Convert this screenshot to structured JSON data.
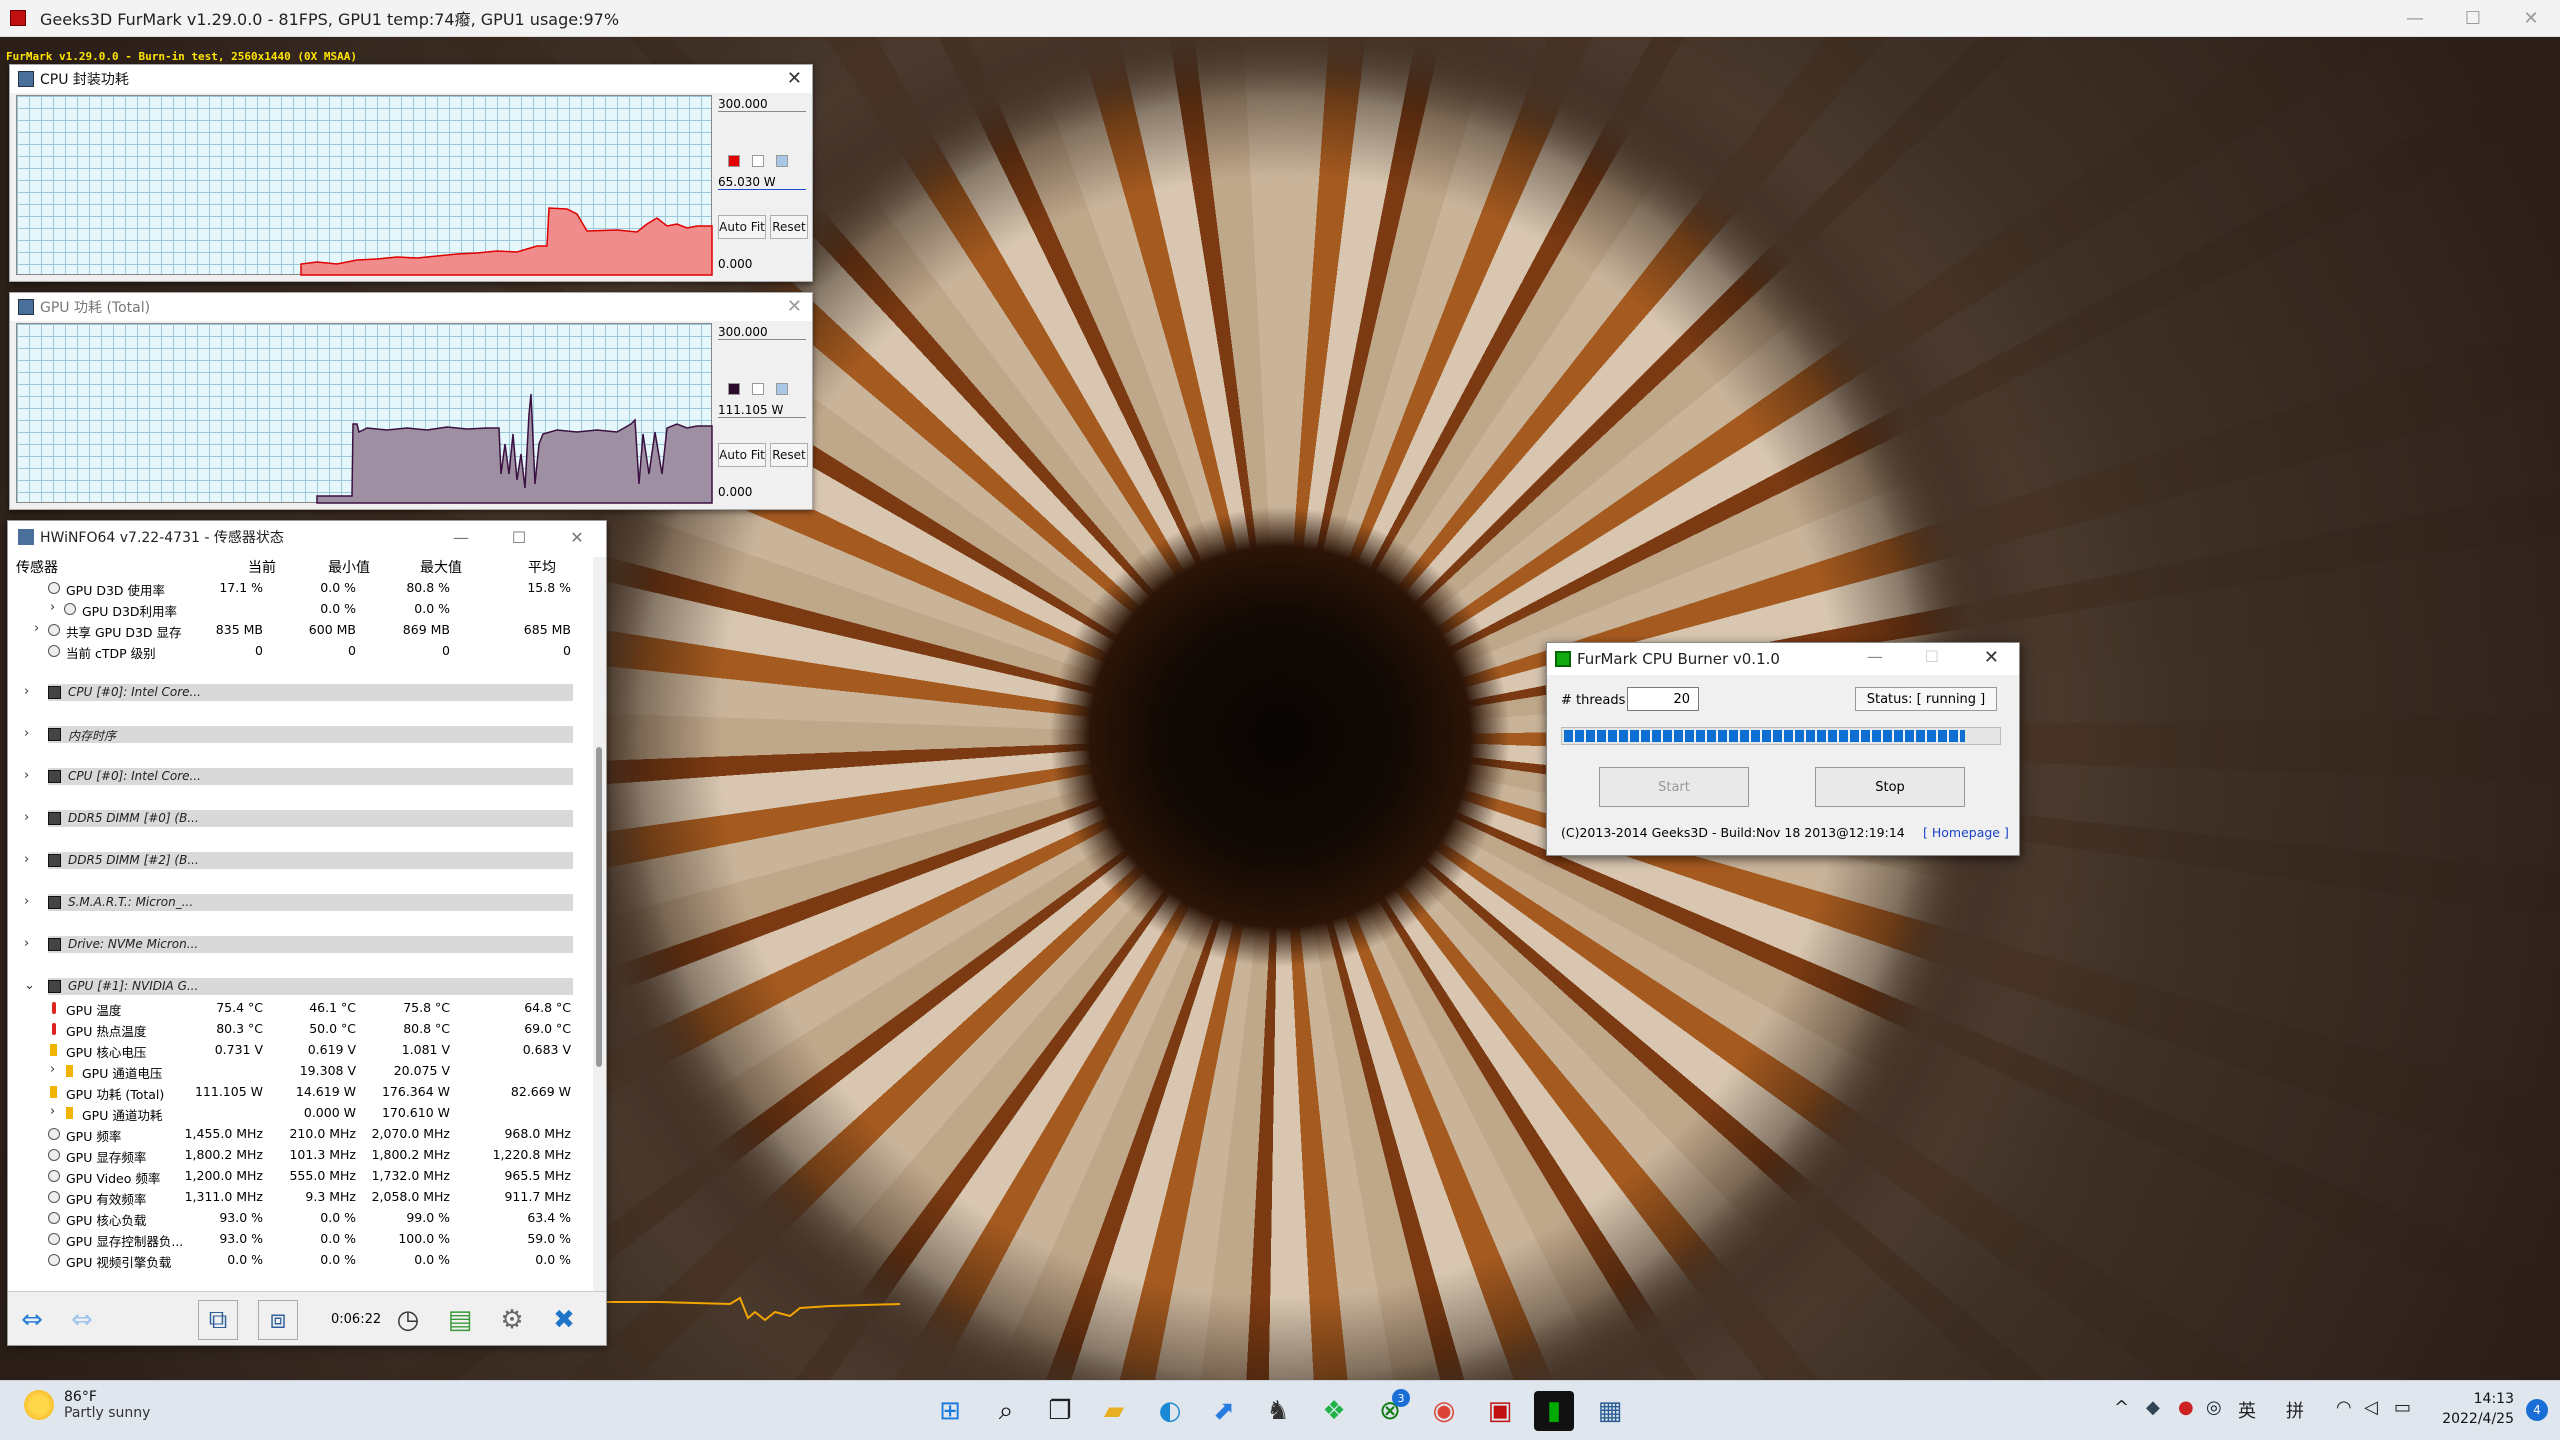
{
  "main_window": {
    "title": "Geeks3D FurMark v1.29.0.0 - 81FPS, GPU1 temp:74癈, GPU1 usage:97%",
    "overlay": "FurMark v1.29.0.0 - Burn-in test, 2560x1440 (0X MSAA)",
    "minimize": "—",
    "maximize": "☐",
    "close": "✕"
  },
  "cpu_graph": {
    "title": "CPU 封装功耗",
    "max": "300.000",
    "current": "65.030 W",
    "min": "0.000",
    "autofit": "Auto Fit",
    "reset": "Reset",
    "color": "#e00000",
    "close": "✕"
  },
  "gpu_graph": {
    "title": "GPU 功耗 (Total)",
    "max": "300.000",
    "current": "111.105 W",
    "min": "0.000",
    "autofit": "Auto Fit",
    "reset": "Reset",
    "color": "#2a0a2a",
    "close": "✕"
  },
  "sensor_window": {
    "title": "HWiNFO64 v7.22-4731 - 传感器状态",
    "columns": [
      "传感器",
      "当前",
      "最小值",
      "最大值",
      "平均"
    ],
    "rows": [
      {
        "type": "s",
        "ind": 0,
        "name": "GPU D3D 使用率",
        "cur": "17.1 %",
        "min": "0.0 %",
        "max": "80.8 %",
        "avg": "15.8 %"
      },
      {
        "type": "s",
        "ind": 1,
        "exp": "›",
        "name": "GPU D3D利用率",
        "cur": "",
        "min": "0.0 %",
        "max": "0.0 %",
        "avg": ""
      },
      {
        "type": "s",
        "ind": 0,
        "exp": "›",
        "name": "共享 GPU D3D 显存",
        "cur": "835 MB",
        "min": "600 MB",
        "max": "869 MB",
        "avg": "685 MB"
      },
      {
        "type": "s",
        "ind": 0,
        "name": "当前 cTDP 级别",
        "cur": "0",
        "min": "0",
        "max": "0",
        "avg": "0"
      },
      {
        "type": "gap"
      },
      {
        "type": "g",
        "exp": "›",
        "name": "CPU [#0]: Intel Core..."
      },
      {
        "type": "gap"
      },
      {
        "type": "g",
        "exp": "›",
        "name": "内存时序"
      },
      {
        "type": "gap"
      },
      {
        "type": "g",
        "exp": "›",
        "name": "CPU [#0]: Intel Core..."
      },
      {
        "type": "gap"
      },
      {
        "type": "g",
        "exp": "›",
        "name": "DDR5 DIMM [#0] (B..."
      },
      {
        "type": "gap"
      },
      {
        "type": "g",
        "exp": "›",
        "name": "DDR5 DIMM [#2] (B..."
      },
      {
        "type": "gap"
      },
      {
        "type": "g",
        "exp": "›",
        "name": "S.M.A.R.T.: Micron_..."
      },
      {
        "type": "gap"
      },
      {
        "type": "g",
        "exp": "›",
        "name": "Drive: NVMe Micron..."
      },
      {
        "type": "gap"
      },
      {
        "type": "g",
        "exp": "⌄",
        "name": "GPU [#1]: NVIDIA G..."
      },
      {
        "type": "t",
        "name": "GPU 温度",
        "cur": "75.4 °C",
        "min": "46.1 °C",
        "max": "75.8 °C",
        "avg": "64.8 °C"
      },
      {
        "type": "t",
        "name": "GPU 热点温度",
        "cur": "80.3 °C",
        "min": "50.0 °C",
        "max": "80.8 °C",
        "avg": "69.0 °C"
      },
      {
        "type": "v",
        "name": "GPU 核心电压",
        "cur": "0.731 V",
        "min": "0.619 V",
        "max": "1.081 V",
        "avg": "0.683 V"
      },
      {
        "type": "v",
        "ind": 1,
        "exp": "›",
        "name": "GPU 通道电压",
        "cur": "",
        "min": "19.308 V",
        "max": "20.075 V",
        "avg": ""
      },
      {
        "type": "v",
        "name": "GPU 功耗 (Total)",
        "cur": "111.105 W",
        "min": "14.619 W",
        "max": "176.364 W",
        "avg": "82.669 W"
      },
      {
        "type": "v",
        "ind": 1,
        "exp": "›",
        "name": "GPU 通道功耗",
        "cur": "",
        "min": "0.000 W",
        "max": "170.610 W",
        "avg": ""
      },
      {
        "type": "s",
        "name": "GPU 频率",
        "cur": "1,455.0 MHz",
        "min": "210.0 MHz",
        "max": "2,070.0 MHz",
        "avg": "968.0 MHz"
      },
      {
        "type": "s",
        "name": "GPU 显存频率",
        "cur": "1,800.2 MHz",
        "min": "101.3 MHz",
        "max": "1,800.2 MHz",
        "avg": "1,220.8 MHz"
      },
      {
        "type": "s",
        "name": "GPU Video 频率",
        "cur": "1,200.0 MHz",
        "min": "555.0 MHz",
        "max": "1,732.0 MHz",
        "avg": "965.5 MHz"
      },
      {
        "type": "s",
        "name": "GPU 有效频率",
        "cur": "1,311.0 MHz",
        "min": "9.3 MHz",
        "max": "2,058.0 MHz",
        "avg": "911.7 MHz"
      },
      {
        "type": "s",
        "name": "GPU 核心负载",
        "cur": "93.0 %",
        "min": "0.0 %",
        "max": "99.0 %",
        "avg": "63.4 %"
      },
      {
        "type": "s",
        "name": "GPU 显存控制器负...",
        "cur": "93.0 %",
        "min": "0.0 %",
        "max": "100.0 %",
        "avg": "59.0 %"
      },
      {
        "type": "s",
        "name": "GPU 视频引擎负载",
        "cur": "0.0 %",
        "min": "0.0 %",
        "max": "0.0 %",
        "avg": "0.0 %"
      }
    ],
    "timer": "0:06:22"
  },
  "burner": {
    "title": "FurMark CPU Burner v0.1.0",
    "threads_label": "# threads",
    "threads_value": "20",
    "status": "Status: [ running ]",
    "progress": 0.92,
    "start": "Start",
    "stop": "Stop",
    "copyright": "(C)2013-2014 Geeks3D - Build:Nov 18 2013@12:19:14",
    "homepage": "[ Homepage ]"
  },
  "taskbar": {
    "temp": "86°F",
    "weather": "Partly sunny",
    "time": "14:13",
    "date": "2022/4/25",
    "ime1": "英",
    "ime2": "拼",
    "badge": "3",
    "notifications": "4"
  }
}
